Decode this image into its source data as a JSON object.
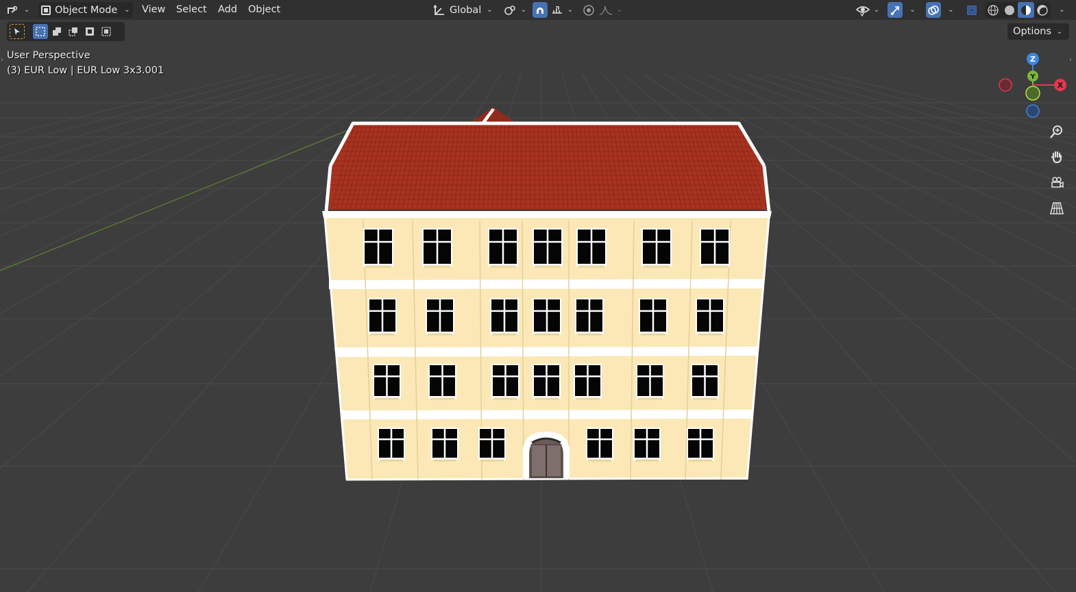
{
  "header": {
    "mode_label": "Object Mode",
    "menus": [
      "View",
      "Select",
      "Add",
      "Object"
    ],
    "orientation_label": "Global"
  },
  "toolbar": {
    "options_label": "Options"
  },
  "viewport": {
    "view_name": "User Perspective",
    "object_info": "(3) EUR Low | EUR Low 3x3.001"
  },
  "gizmo": {
    "x_label": "X",
    "y_label": "Y",
    "z_label": "Z",
    "colors": {
      "x": "#e1384d",
      "y": "#7ab63a",
      "z": "#3b86e3"
    }
  },
  "colors": {
    "header_bg": "#303030",
    "viewport_bg": "#3d3d3d",
    "accent": "#4772b3",
    "roof": "#a8331f",
    "facade": "#fbe8b6",
    "trim": "#ffffff"
  },
  "icons": [
    "editor-type-icon",
    "object-mode-icon",
    "transform-orientation-icon",
    "pivot-icon",
    "snap-icon",
    "snap-increment-icon",
    "proportional-edit-icon",
    "falloff-icon",
    "visibility-icon",
    "gizmo-toggle-icon",
    "overlay-icon",
    "xray-icon",
    "shading-wireframe-icon",
    "shading-solid-icon",
    "shading-material-icon",
    "shading-rendered-icon",
    "zoom-icon",
    "hand-pan-icon",
    "camera-icon",
    "grid-perspective-icon"
  ]
}
